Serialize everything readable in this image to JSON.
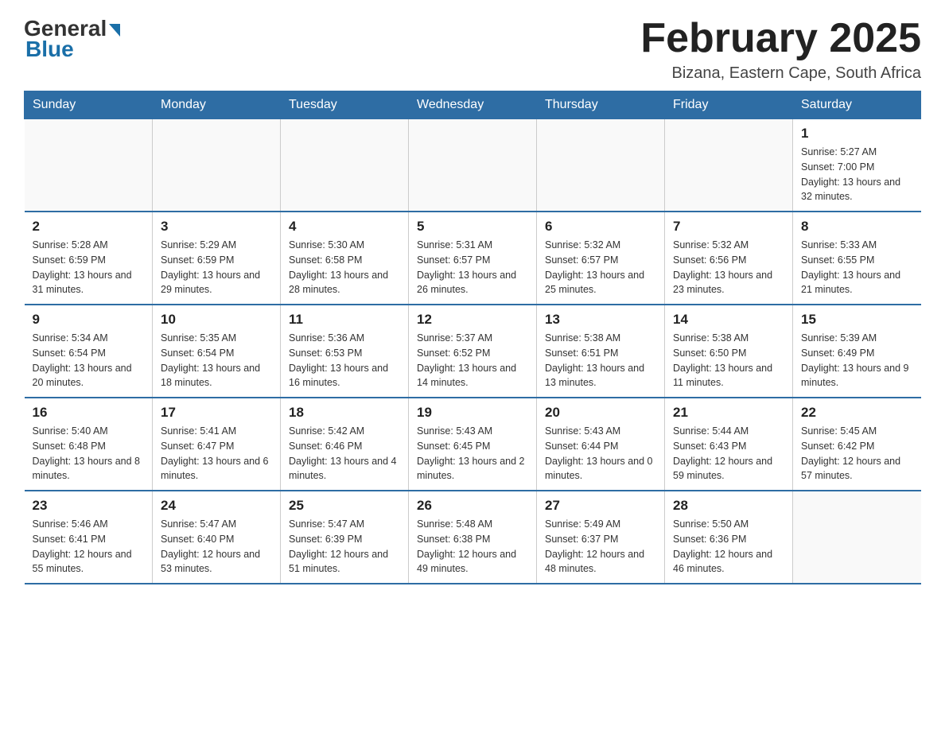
{
  "header": {
    "logo_general": "General",
    "logo_blue": "Blue",
    "month_title": "February 2025",
    "location": "Bizana, Eastern Cape, South Africa"
  },
  "weekdays": [
    "Sunday",
    "Monday",
    "Tuesday",
    "Wednesday",
    "Thursday",
    "Friday",
    "Saturday"
  ],
  "weeks": [
    [
      {
        "day": "",
        "info": ""
      },
      {
        "day": "",
        "info": ""
      },
      {
        "day": "",
        "info": ""
      },
      {
        "day": "",
        "info": ""
      },
      {
        "day": "",
        "info": ""
      },
      {
        "day": "",
        "info": ""
      },
      {
        "day": "1",
        "info": "Sunrise: 5:27 AM\nSunset: 7:00 PM\nDaylight: 13 hours and 32 minutes."
      }
    ],
    [
      {
        "day": "2",
        "info": "Sunrise: 5:28 AM\nSunset: 6:59 PM\nDaylight: 13 hours and 31 minutes."
      },
      {
        "day": "3",
        "info": "Sunrise: 5:29 AM\nSunset: 6:59 PM\nDaylight: 13 hours and 29 minutes."
      },
      {
        "day": "4",
        "info": "Sunrise: 5:30 AM\nSunset: 6:58 PM\nDaylight: 13 hours and 28 minutes."
      },
      {
        "day": "5",
        "info": "Sunrise: 5:31 AM\nSunset: 6:57 PM\nDaylight: 13 hours and 26 minutes."
      },
      {
        "day": "6",
        "info": "Sunrise: 5:32 AM\nSunset: 6:57 PM\nDaylight: 13 hours and 25 minutes."
      },
      {
        "day": "7",
        "info": "Sunrise: 5:32 AM\nSunset: 6:56 PM\nDaylight: 13 hours and 23 minutes."
      },
      {
        "day": "8",
        "info": "Sunrise: 5:33 AM\nSunset: 6:55 PM\nDaylight: 13 hours and 21 minutes."
      }
    ],
    [
      {
        "day": "9",
        "info": "Sunrise: 5:34 AM\nSunset: 6:54 PM\nDaylight: 13 hours and 20 minutes."
      },
      {
        "day": "10",
        "info": "Sunrise: 5:35 AM\nSunset: 6:54 PM\nDaylight: 13 hours and 18 minutes."
      },
      {
        "day": "11",
        "info": "Sunrise: 5:36 AM\nSunset: 6:53 PM\nDaylight: 13 hours and 16 minutes."
      },
      {
        "day": "12",
        "info": "Sunrise: 5:37 AM\nSunset: 6:52 PM\nDaylight: 13 hours and 14 minutes."
      },
      {
        "day": "13",
        "info": "Sunrise: 5:38 AM\nSunset: 6:51 PM\nDaylight: 13 hours and 13 minutes."
      },
      {
        "day": "14",
        "info": "Sunrise: 5:38 AM\nSunset: 6:50 PM\nDaylight: 13 hours and 11 minutes."
      },
      {
        "day": "15",
        "info": "Sunrise: 5:39 AM\nSunset: 6:49 PM\nDaylight: 13 hours and 9 minutes."
      }
    ],
    [
      {
        "day": "16",
        "info": "Sunrise: 5:40 AM\nSunset: 6:48 PM\nDaylight: 13 hours and 8 minutes."
      },
      {
        "day": "17",
        "info": "Sunrise: 5:41 AM\nSunset: 6:47 PM\nDaylight: 13 hours and 6 minutes."
      },
      {
        "day": "18",
        "info": "Sunrise: 5:42 AM\nSunset: 6:46 PM\nDaylight: 13 hours and 4 minutes."
      },
      {
        "day": "19",
        "info": "Sunrise: 5:43 AM\nSunset: 6:45 PM\nDaylight: 13 hours and 2 minutes."
      },
      {
        "day": "20",
        "info": "Sunrise: 5:43 AM\nSunset: 6:44 PM\nDaylight: 13 hours and 0 minutes."
      },
      {
        "day": "21",
        "info": "Sunrise: 5:44 AM\nSunset: 6:43 PM\nDaylight: 12 hours and 59 minutes."
      },
      {
        "day": "22",
        "info": "Sunrise: 5:45 AM\nSunset: 6:42 PM\nDaylight: 12 hours and 57 minutes."
      }
    ],
    [
      {
        "day": "23",
        "info": "Sunrise: 5:46 AM\nSunset: 6:41 PM\nDaylight: 12 hours and 55 minutes."
      },
      {
        "day": "24",
        "info": "Sunrise: 5:47 AM\nSunset: 6:40 PM\nDaylight: 12 hours and 53 minutes."
      },
      {
        "day": "25",
        "info": "Sunrise: 5:47 AM\nSunset: 6:39 PM\nDaylight: 12 hours and 51 minutes."
      },
      {
        "day": "26",
        "info": "Sunrise: 5:48 AM\nSunset: 6:38 PM\nDaylight: 12 hours and 49 minutes."
      },
      {
        "day": "27",
        "info": "Sunrise: 5:49 AM\nSunset: 6:37 PM\nDaylight: 12 hours and 48 minutes."
      },
      {
        "day": "28",
        "info": "Sunrise: 5:50 AM\nSunset: 6:36 PM\nDaylight: 12 hours and 46 minutes."
      },
      {
        "day": "",
        "info": ""
      }
    ]
  ]
}
